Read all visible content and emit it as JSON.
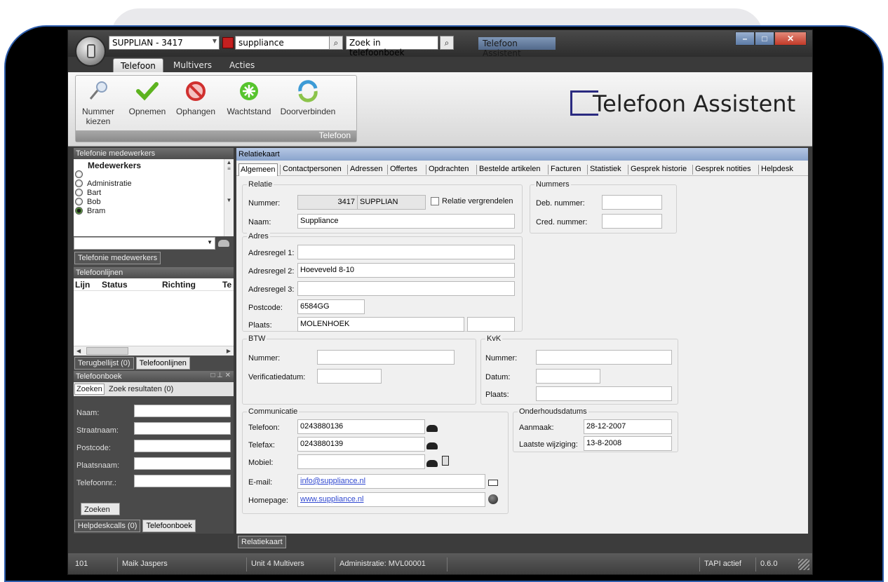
{
  "titlebar": {
    "line_combo": "SUPPLIAN - 3417",
    "search_value": "suppliance",
    "phonebook_search_label": "Zoek in telefoonboek",
    "app_title": "Telefoon Assistent"
  },
  "ribbon": {
    "tabs": [
      "Telefoon",
      "Multivers",
      "Acties"
    ],
    "buttons": [
      {
        "label": "Nummer kiezen",
        "icon": "dial-icon"
      },
      {
        "label": "Opnemen",
        "icon": "check-icon"
      },
      {
        "label": "Ophangen",
        "icon": "hangup-icon"
      },
      {
        "label": "Wachtstand",
        "icon": "hold-icon"
      },
      {
        "label": "Doorverbinden",
        "icon": "transfer-icon"
      }
    ],
    "group_label": "Telefoon",
    "logo_text": "Telefoon Assistent"
  },
  "left": {
    "employees_title": "Telefonie medewerkers",
    "employees_header": "Medewerkers",
    "employees": [
      {
        "name": "",
        "status": "off"
      },
      {
        "name": "Administratie",
        "status": "off"
      },
      {
        "name": "Bart",
        "status": "off"
      },
      {
        "name": "Bob",
        "status": "off"
      },
      {
        "name": "Bram",
        "status": "on"
      }
    ],
    "employees_tab": "Telefonie medewerkers",
    "lines_title": "Telefoonlijnen",
    "lines_columns": [
      "Lijn",
      "Status",
      "Richting",
      "Te"
    ],
    "lines_tabs": [
      "Terugbellijst (0)",
      "Telefoonlijnen"
    ],
    "phonebook_title": "Telefoonboek",
    "phonebook_tabs": [
      "Zoeken",
      "Zoek resultaten (0)"
    ],
    "phonebook_fields": [
      "Naam:",
      "Straatnaam:",
      "Postcode:",
      "Plaatsnaam:",
      "Telefoonnr.:"
    ],
    "search_button": "Zoeken",
    "bottom_tabs": [
      "Helpdeskcalls (0)",
      "Telefoonboek"
    ]
  },
  "main": {
    "title": "Relatiekaart",
    "tabs": [
      "Algemeen",
      "Contactpersonen",
      "Adressen",
      "Offertes",
      "Opdrachten",
      "Bestelde artikelen",
      "Facturen",
      "Statistiek",
      "Gesprek historie",
      "Gesprek notities",
      "Helpdesk"
    ],
    "relatie": {
      "legend": "Relatie",
      "nummer_label": "Nummer:",
      "nummer_value": "3417",
      "code_value": "SUPPLIAN",
      "lock_label": "Relatie vergrendelen",
      "naam_label": "Naam:",
      "naam_value": "Suppliance"
    },
    "nummers": {
      "legend": "Nummers",
      "deb_label": "Deb. nummer:",
      "cred_label": "Cred. nummer:"
    },
    "adres": {
      "legend": "Adres",
      "regel1_label": "Adresregel 1:",
      "regel1_value": "",
      "regel2_label": "Adresregel 2:",
      "regel2_value": "Hoeveveld 8-10",
      "regel3_label": "Adresregel 3:",
      "regel3_value": "",
      "postcode_label": "Postcode:",
      "postcode_value": "6584GG",
      "plaats_label": "Plaats:",
      "plaats_value": "MOLENHOEK"
    },
    "btw": {
      "legend": "BTW",
      "nummer_label": "Nummer:",
      "verificatie_label": "Verificatiedatum:"
    },
    "kvk": {
      "legend": "KvK",
      "nummer_label": "Nummer:",
      "datum_label": "Datum:",
      "plaats_label": "Plaats:"
    },
    "communicatie": {
      "legend": "Communicatie",
      "telefoon_label": "Telefoon:",
      "telefoon_value": "0243880136",
      "telefax_label": "Telefax:",
      "telefax_value": "0243880139",
      "mobiel_label": "Mobiel:",
      "email_label": "E-mail:",
      "email_value": "info@suppliance.nl",
      "homepage_label": "Homepage:",
      "homepage_value": "www.suppliance.nl"
    },
    "onderhoud": {
      "legend": "Onderhoudsdatums",
      "aanmaak_label": "Aanmaak:",
      "aanmaak_value": "28-12-2007",
      "wijziging_label": "Laatste wijziging:",
      "wijziging_value": "13-8-2008"
    },
    "bottom_tab": "Relatiekaart"
  },
  "statusbar": {
    "cells": [
      "101",
      "Maik Jaspers",
      "Unit 4 Multivers",
      "Administratie: MVL00001",
      "TAPI actief",
      "0.6.0"
    ]
  }
}
